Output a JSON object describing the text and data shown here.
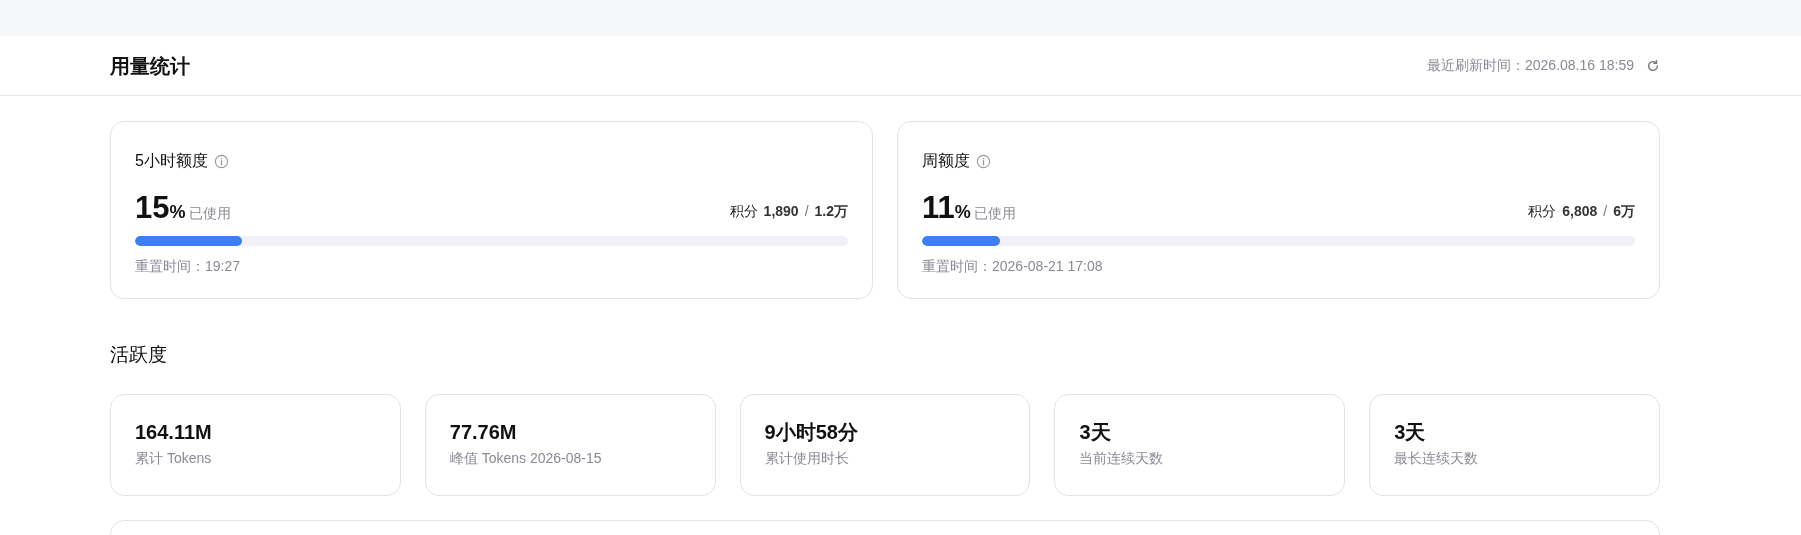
{
  "header": {
    "title": "用量统计",
    "refresh_label": "最近刷新时间：2026.08.16 18:59"
  },
  "quotas": [
    {
      "title": "5小时额度",
      "percent": "15",
      "percent_sign": "%",
      "used_label": "已使用",
      "points_label": "积分",
      "points_used": "1,890",
      "separator": "/",
      "points_total": "1.2万",
      "level": 0.15,
      "reset": "重置时间：19:27"
    },
    {
      "title": "周额度",
      "percent": "11",
      "percent_sign": "%",
      "used_label": "已使用",
      "points_label": "积分",
      "points_used": "6,808",
      "separator": "/",
      "points_total": "6万",
      "level": 0.11,
      "reset": "重置时间：2026-08-21 17:08"
    }
  ],
  "activity": {
    "title": "活跃度",
    "stats": [
      {
        "value": "164.11M",
        "label": "累计 Tokens"
      },
      {
        "value": "77.76M",
        "label": "峰值 Tokens 2026-08-15"
      },
      {
        "value": "9小时58分",
        "label": "累计使用时长"
      },
      {
        "value": "3天",
        "label": "当前连续天数"
      },
      {
        "value": "3天",
        "label": "最长连续天数"
      }
    ]
  }
}
